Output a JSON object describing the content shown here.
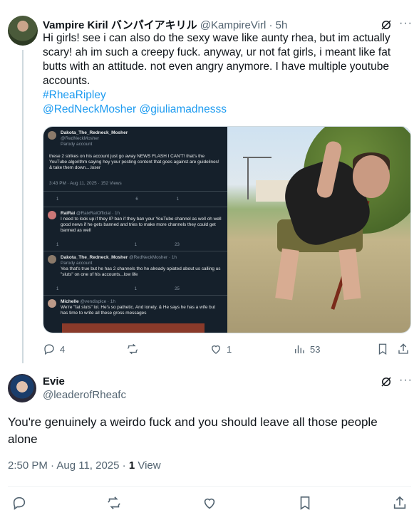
{
  "tweet1": {
    "display_name": "Vampire Kiril バンパイアキリル",
    "handle": "@KampireVirl",
    "separator": "·",
    "time": "5h",
    "text": "Hi girls! see i can also do the sexy wave like aunty rhea, but im actually scary! ah im such a creepy fuck. anyway, ur not fat girls, i meant like fat butts with an attitude. not even angry anymore. I have multiple youtube accounts.",
    "hashtag": "#RheaRipley",
    "mentions": "@RedNeckMosher @giuliamadnesss",
    "media_screenshot": {
      "post": {
        "name": "Dakota_The_Redneck_Mosher",
        "handle": "@RedNeckMosher",
        "label": "Parody account",
        "text": "these 2 strikes on his account just go away NEWS FLASH I CAN'T! that's the YouTube algorithm saying hey your posting content that goes against are guidelines! & take them down....loser",
        "meta": "3:43 PM · Aug 11, 2025 · 152 Views",
        "counts": [
          "1",
          "",
          "6",
          "1",
          ""
        ]
      },
      "replies": [
        {
          "name": "RaiRai",
          "handle": "@RaixRaiOfficial · 1h",
          "text": "I need to look up if they IP ban if they ban your YouTube channel as well oh well good news if he gets banned and tries to make more channels they could get banned as well",
          "counts": [
            "1",
            "",
            "1",
            "23",
            ""
          ]
        },
        {
          "name": "Dakota_The_Redneck_Mosher",
          "handle": "@RedNeckMosher · 1h",
          "label": "Parody account",
          "text": "Yea that's true but he has 2 channels tho he already opiated about us calling us \"sluts\" on one of his accounts...low life",
          "counts": [
            "1",
            "",
            "1",
            "25",
            ""
          ]
        },
        {
          "name": "Michelle",
          "handle": "@vendisplce · 1h",
          "text": "We're \"fat sluts\" lol. He's so pathetic. And lonely. & He says he has a wife but has time to write all these gross messages",
          "counts": []
        }
      ]
    },
    "stats": {
      "replies": "4",
      "reposts": "",
      "likes": "1",
      "views": "53"
    }
  },
  "tweet2": {
    "display_name": "Evie",
    "handle": "@leaderofRheafc",
    "text": "You're genuinely a weirdo fuck and you should leave all those people alone",
    "time": "2:50 PM · Aug 11, 2025 · ",
    "views_count": "1",
    "views_label": "View"
  },
  "icons": {
    "grok": "grok-icon",
    "more": "more-icon",
    "reply": "reply-icon",
    "repost": "repost-icon",
    "like": "like-icon",
    "views": "views-icon",
    "bookmark": "bookmark-icon",
    "share": "share-icon"
  },
  "colors": {
    "link": "#1d9bf0",
    "secondary_text": "#536471",
    "primary_text": "#0f1419",
    "dark_media_bg": "#15202b"
  }
}
